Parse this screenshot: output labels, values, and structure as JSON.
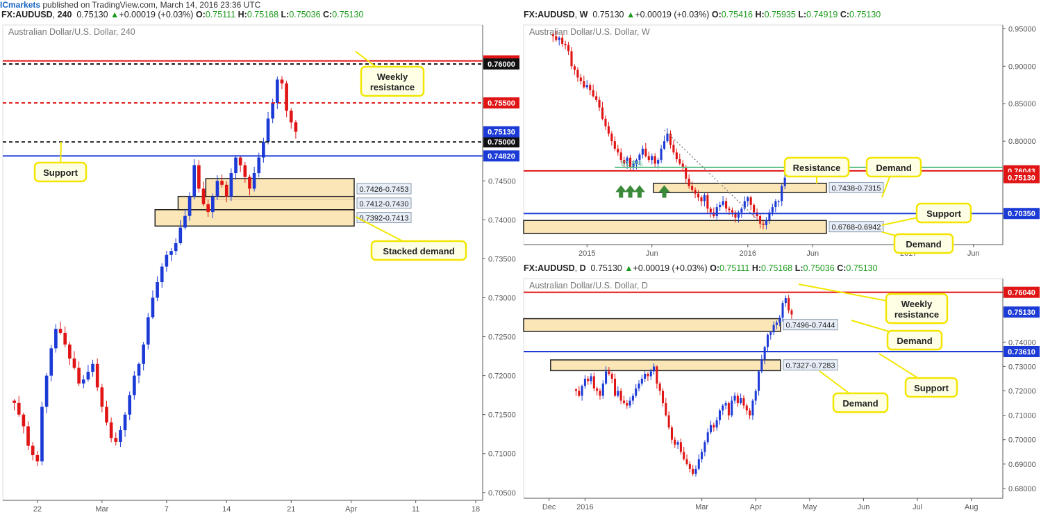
{
  "header": {
    "brand": "ICmarkets",
    "text": " published on TradingView.com, March 14, 2016 23:36 UTC"
  },
  "colors": {
    "bull": "#1c3ad6",
    "bear": "#e01414",
    "zone_fill": "#fbe3b0",
    "callout_border": "#f2e600",
    "resistance": "#e01414",
    "support": "#1c3ad6",
    "fib": "#5dbf8a"
  },
  "chart_data": [
    {
      "id": "h4",
      "type": "candlestick",
      "symbol": "FX:AUDUSD",
      "timeframe": "240",
      "title": "Australian Dollar/U.S. Dollar, 240",
      "ohlc_header": {
        "last": "0.75130",
        "change": "+0.00019 (+0.03%)",
        "O": "0.75111",
        "H": "0.75168",
        "L": "0.75036",
        "C": "0.75130"
      },
      "ylim": [
        0.704,
        0.765
      ],
      "yticks": [
        "0.70500",
        "0.71000",
        "0.71500",
        "0.72000",
        "0.72500",
        "0.73000",
        "0.73500",
        "0.74000",
        "0.74500"
      ],
      "yticks_values": [
        0.705,
        0.71,
        0.715,
        0.72,
        0.725,
        0.73,
        0.735,
        0.74,
        0.745
      ],
      "xticks": [
        "22",
        "Mar",
        "7",
        "14",
        "21",
        "Apr",
        "11",
        "18"
      ],
      "xticks_bar": [
        7,
        21,
        35,
        48,
        62,
        75,
        89,
        102
      ],
      "n_bars": 104,
      "candles_start": 0,
      "candles_close": [
        0.7165,
        0.715,
        0.7135,
        0.711,
        0.7098,
        0.709,
        0.716,
        0.72,
        0.7235,
        0.726,
        0.7255,
        0.724,
        0.7222,
        0.721,
        0.719,
        0.7195,
        0.7205,
        0.7215,
        0.7185,
        0.716,
        0.714,
        0.712,
        0.7115,
        0.713,
        0.715,
        0.7175,
        0.72,
        0.7215,
        0.724,
        0.7275,
        0.73,
        0.732,
        0.734,
        0.7355,
        0.736,
        0.737,
        0.739,
        0.7405,
        0.743,
        0.747,
        0.744,
        0.742,
        0.741,
        0.743,
        0.745,
        0.7445,
        0.743,
        0.746,
        0.748,
        0.747,
        0.7455,
        0.744,
        0.746,
        0.748,
        0.75,
        0.753,
        0.755,
        0.758,
        0.7575,
        0.754,
        0.7525,
        0.7513
      ],
      "price_lines": [
        {
          "value": 0.7604,
          "label": "0.76040",
          "style": "solid",
          "color": "#e01414"
        },
        {
          "value": 0.76,
          "label": "0.76000",
          "style": "dashed",
          "color": "#111111"
        },
        {
          "value": 0.755,
          "label": "0.75500",
          "style": "dashed",
          "color": "#e01414"
        },
        {
          "value": 0.75,
          "label": "0.75000",
          "style": "dashed",
          "color": "#111111"
        },
        {
          "value": 0.7482,
          "label": "0.74820",
          "style": "solid",
          "color": "#1c3ad6"
        }
      ],
      "last_price_label": "0.75130",
      "zones": [
        {
          "label": "0.7426-0.7453",
          "top": 0.7453,
          "bottom": 0.7426,
          "start_bar": 44
        },
        {
          "label": "0.7412-0.7430",
          "top": 0.743,
          "bottom": 0.7412,
          "start_bar": 38
        },
        {
          "label": "0.7392-0.7413",
          "top": 0.7413,
          "bottom": 0.7392,
          "start_bar": 33
        }
      ],
      "callouts": [
        {
          "text_lines": [
            "Weekly",
            "resistance"
          ]
        },
        {
          "text_lines": [
            "Support"
          ]
        },
        {
          "text_lines": [
            "Stacked demand"
          ]
        }
      ]
    },
    {
      "id": "weekly",
      "type": "candlestick",
      "symbol": "FX:AUDUSD",
      "timeframe": "W",
      "title": "Australian Dollar/U.S. Dollar, W",
      "ohlc_header": {
        "last": "0.75130",
        "change": "+0.00019 (+0.03%)",
        "O": "0.75416",
        "H": "0.75935",
        "L": "0.74919",
        "C": "0.75130"
      },
      "ylim": [
        0.662,
        0.955
      ],
      "yticks": [
        "0.95000",
        "0.90000",
        "0.85000",
        "0.80000",
        "0.75000",
        "0.70000"
      ],
      "yticks_values": [
        0.95,
        0.9,
        0.85,
        0.8,
        0.75,
        0.7
      ],
      "xticks": [
        "2015",
        "Jun",
        "2016",
        "Jun",
        "2017",
        "Jun"
      ],
      "xticks_bar": [
        20,
        41,
        72,
        93,
        124,
        145
      ],
      "n_bars": 155,
      "candles_start": 0,
      "candles_close": [
        0.94,
        0.935,
        0.938,
        0.93,
        0.928,
        0.92,
        0.9,
        0.895,
        0.885,
        0.88,
        0.872,
        0.875,
        0.868,
        0.86,
        0.855,
        0.845,
        0.83,
        0.82,
        0.81,
        0.8,
        0.79,
        0.785,
        0.775,
        0.77,
        0.778,
        0.765,
        0.77,
        0.775,
        0.782,
        0.79,
        0.78,
        0.775,
        0.78,
        0.77,
        0.775,
        0.79,
        0.8,
        0.81,
        0.795,
        0.785,
        0.776,
        0.77,
        0.765,
        0.75,
        0.74,
        0.735,
        0.73,
        0.725,
        0.72,
        0.728,
        0.71,
        0.705,
        0.7,
        0.712,
        0.715,
        0.72,
        0.71,
        0.708,
        0.705,
        0.698,
        0.705,
        0.71,
        0.72,
        0.725,
        0.715,
        0.705,
        0.7,
        0.69,
        0.688,
        0.695,
        0.705,
        0.712,
        0.72,
        0.72,
        0.74,
        0.7513
      ],
      "price_lines": [
        {
          "value": 0.76043,
          "label": "0.76043",
          "style": "solid",
          "color": "#e01414"
        },
        {
          "value": 0.7035,
          "label": "0.70350",
          "style": "solid",
          "color": "#1c3ad6"
        }
      ],
      "last_price_label": "0.75130",
      "fib_line": {
        "value": 0.765,
        "label": "61.8%"
      },
      "zones": [
        {
          "label": "0.7438-0.7315",
          "top": 0.7438,
          "bottom": 0.7315,
          "start_bar": 42
        },
        {
          "label": "0.6768-0.6942",
          "top": 0.6942,
          "bottom": 0.6768,
          "start_bar": 0
        }
      ],
      "callouts": [
        {
          "text_lines": [
            "Resistance"
          ]
        },
        {
          "text_lines": [
            "Demand"
          ]
        },
        {
          "text_lines": [
            "Support"
          ]
        },
        {
          "text_lines": [
            "Demand"
          ]
        }
      ]
    },
    {
      "id": "daily",
      "type": "candlestick",
      "symbol": "FX:AUDUSD",
      "timeframe": "D",
      "title": "Australian Dollar/U.S. Dollar, D",
      "ohlc_header": {
        "last": "0.75130",
        "change": "+0.00019 (+0.03%)",
        "O": "0.75111",
        "H": "0.75168",
        "L": "0.75036",
        "C": "0.75130"
      },
      "ylim": [
        0.676,
        0.766
      ],
      "yticks": [
        "0.74000",
        "0.73000",
        "0.72000",
        "0.71000",
        "0.70000",
        "0.69000",
        "0.68000"
      ],
      "yticks_values": [
        0.74,
        0.73,
        0.72,
        0.71,
        0.7,
        0.69,
        0.68
      ],
      "xticks": [
        "Dec",
        "2016",
        "Mar",
        "Apr",
        "May",
        "Jun",
        "Jul",
        "Aug"
      ],
      "xticks_bar": [
        8,
        20,
        59,
        77,
        95,
        113,
        131,
        149
      ],
      "n_bars": 160,
      "candles_start": 0,
      "candles_close": [
        0.72,
        0.718,
        0.722,
        0.725,
        0.724,
        0.726,
        0.721,
        0.72,
        0.718,
        0.723,
        0.728,
        0.727,
        0.725,
        0.718,
        0.72,
        0.716,
        0.715,
        0.714,
        0.716,
        0.718,
        0.721,
        0.723,
        0.725,
        0.727,
        0.726,
        0.728,
        0.73,
        0.723,
        0.72,
        0.715,
        0.71,
        0.705,
        0.7,
        0.698,
        0.699,
        0.695,
        0.692,
        0.69,
        0.688,
        0.686,
        0.688,
        0.692,
        0.695,
        0.699,
        0.703,
        0.706,
        0.705,
        0.708,
        0.712,
        0.714,
        0.715,
        0.71,
        0.716,
        0.718,
        0.715,
        0.717,
        0.714,
        0.712,
        0.71,
        0.716,
        0.72,
        0.728,
        0.733,
        0.738,
        0.743,
        0.744,
        0.747,
        0.748,
        0.75,
        0.756,
        0.758,
        0.753,
        0.7513
      ],
      "price_lines": [
        {
          "value": 0.7604,
          "label": "0.76040",
          "style": "solid",
          "color": "#e01414"
        },
        {
          "value": 0.7361,
          "label": "0.73610",
          "style": "solid",
          "color": "#1c3ad6"
        }
      ],
      "last_price_label": "0.75130",
      "zones": [
        {
          "label": "0.7496-0.7444",
          "top": 0.7496,
          "bottom": 0.7444,
          "start_bar": 0
        },
        {
          "label": "0.7327-0.7283",
          "top": 0.7327,
          "bottom": 0.7283,
          "start_bar": 9
        }
      ],
      "callouts": [
        {
          "text_lines": [
            "Weekly",
            "resistance"
          ]
        },
        {
          "text_lines": [
            "Demand"
          ]
        },
        {
          "text_lines": [
            "Support"
          ]
        },
        {
          "text_lines": [
            "Demand"
          ]
        }
      ]
    }
  ]
}
